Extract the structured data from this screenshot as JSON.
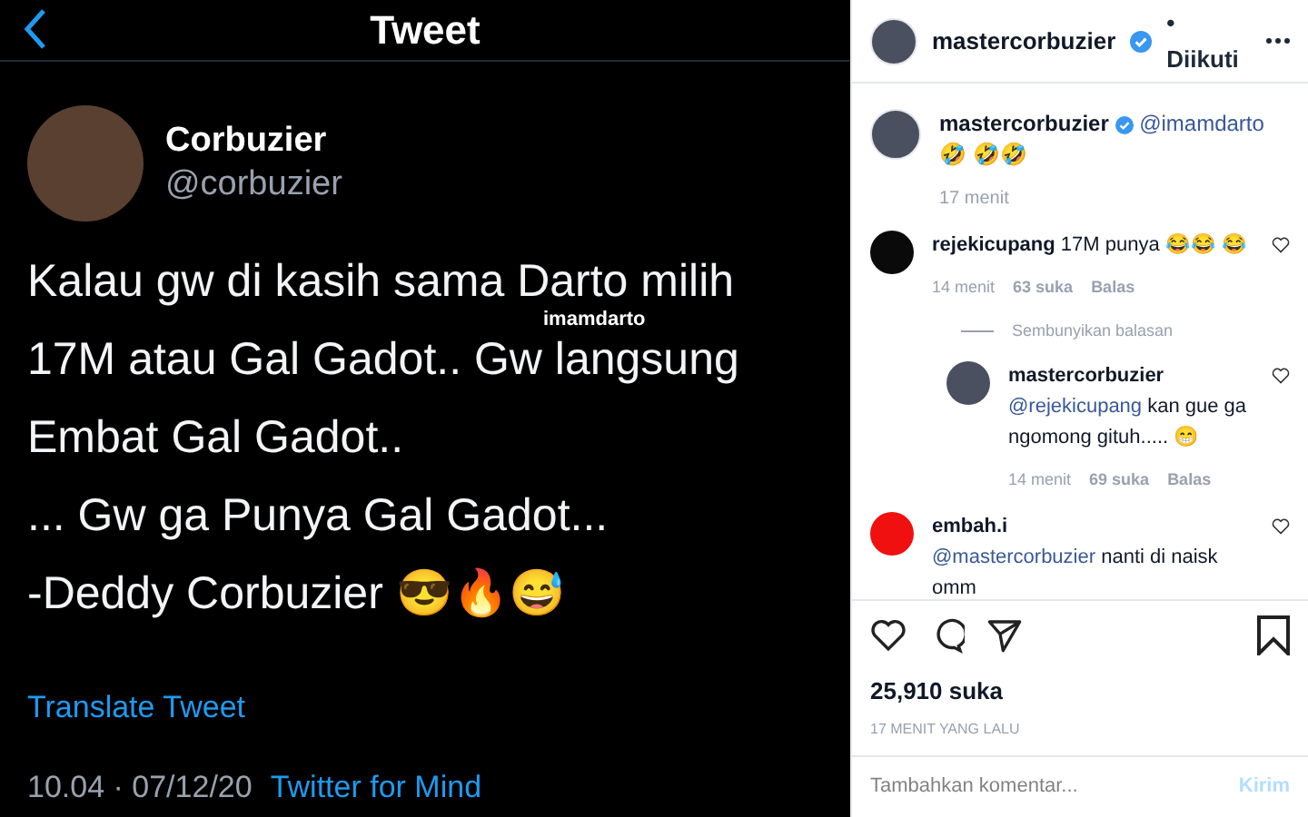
{
  "tweet": {
    "header_title": "Tweet",
    "name": "Corbuzier",
    "handle": "@corbuzier",
    "lines": [
      "Kalau gw di kasih sama Darto milih",
      "17M atau Gal Gadot.. Gw langsung",
      "Embat Gal Gadot..",
      "... Gw ga Punya Gal Gadot...",
      "-Deddy Corbuzier 😎🔥😅"
    ],
    "tag": "imamdarto",
    "translate": "Translate Tweet",
    "timestamp": "10.04 · 07/12/20",
    "source": "Twitter for Mind"
  },
  "post_header": {
    "username": "mastercorbuzier",
    "verified": true,
    "follow_state": "• Diikuti"
  },
  "caption": {
    "username": "mastercorbuzier",
    "verified": true,
    "mention": "@imamdarto",
    "text": " 🤣 🤣🤣",
    "time": "17 menit"
  },
  "comments": [
    {
      "username": "rejekicupang",
      "text": "17M punya 😂😂 😂",
      "time": "14 menit",
      "likes": "63 suka",
      "reply": "Balas",
      "color": "#0a0a0a",
      "kind": "comment"
    },
    {
      "hide_replies": "Sembunyikan balasan",
      "kind": "toggle"
    },
    {
      "username": "mastercorbuzier",
      "mention": "@rejekicupang",
      "text": " kan gue ga ngomong gituh..... 😁",
      "time": "14 menit",
      "likes": "69 suka",
      "reply": "Balas",
      "color": "#4a5060",
      "kind": "reply"
    },
    {
      "username": "embah.i",
      "mention": "@mastercorbuzier",
      "text": " nanti di naisk omm",
      "color": "#f01010",
      "kind": "comment"
    }
  ],
  "likes": "25,910 suka",
  "posted": "17 MENIT YANG LALU",
  "comment_field": {
    "placeholder": "Tambahkan komentar...",
    "submit": "Kirim"
  }
}
